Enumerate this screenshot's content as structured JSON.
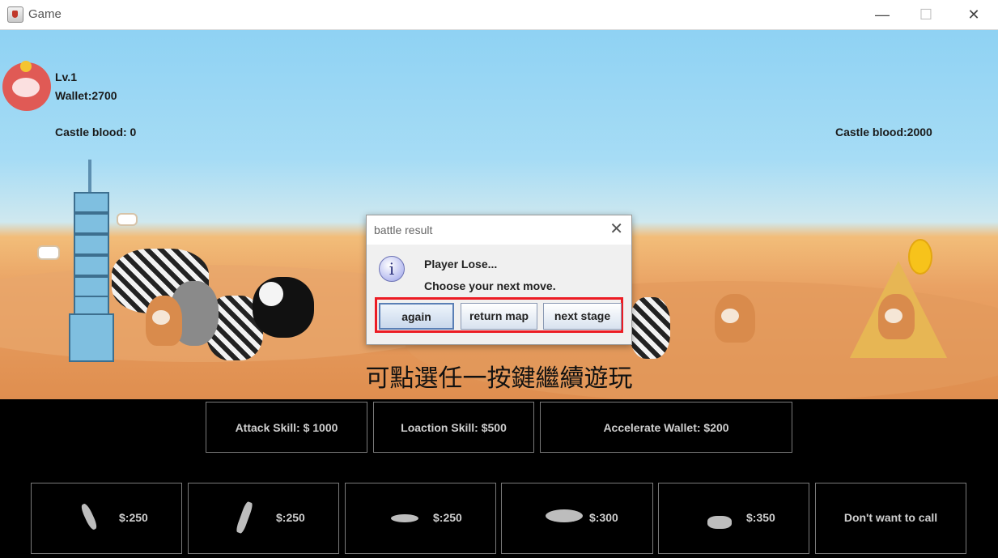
{
  "window": {
    "title": "Game",
    "minimize": "—",
    "maximize": "☐",
    "close": "✕"
  },
  "hud": {
    "level": "Lv.1",
    "wallet": "Wallet:2700",
    "castle_left": "Castle blood: 0",
    "castle_right": "Castle blood:2000"
  },
  "game": {
    "continue_hint": "可點選任一按鍵繼續遊玩"
  },
  "dialog": {
    "title": "battle result",
    "close": "✕",
    "icon": "i",
    "line1": "Player Lose...",
    "line2": "Choose your next move.",
    "buttons": {
      "again": "again",
      "return_map": "return map",
      "next_stage": "next stage"
    },
    "highlight_color": "#ec1c24"
  },
  "skills": {
    "attack": "Attack Skill: $ 1000",
    "location": "Loaction Skill: $500",
    "accelerate": "Accelerate Wallet: $200"
  },
  "units": [
    {
      "icon": "koala-silhouette-icon",
      "price": "$:250"
    },
    {
      "icon": "giraffe-silhouette-icon",
      "price": "$:250"
    },
    {
      "icon": "shark-silhouette-icon",
      "price": "$:250"
    },
    {
      "icon": "whale-silhouette-icon",
      "price": "$:300"
    },
    {
      "icon": "rhino-silhouette-icon",
      "price": "$:350"
    }
  ],
  "no_call": "Don't want to call"
}
